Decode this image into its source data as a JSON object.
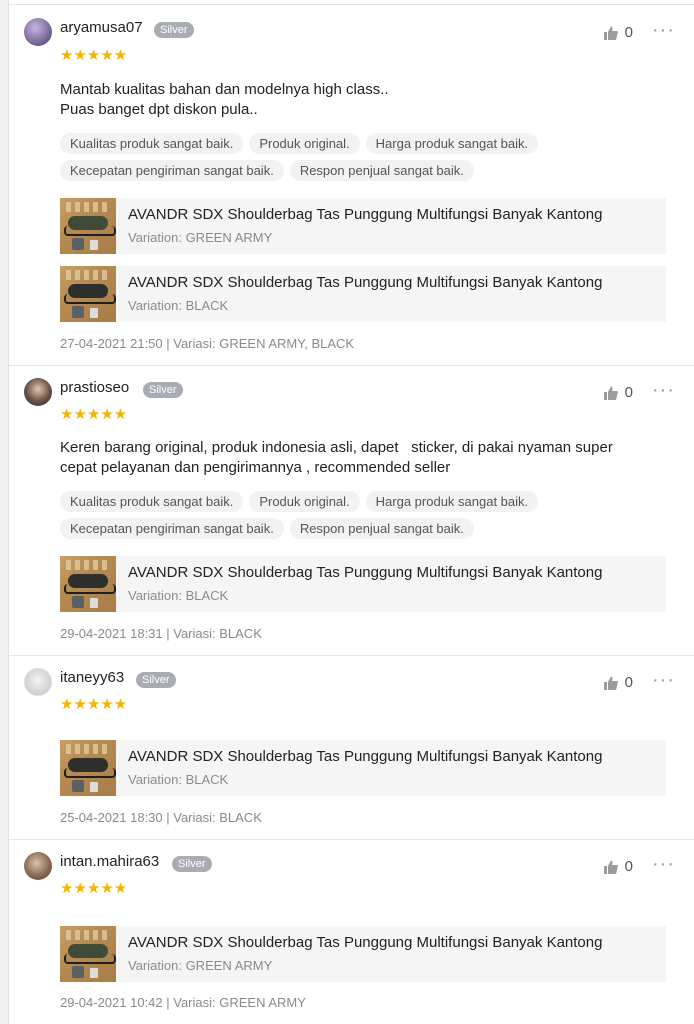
{
  "reviews": [
    {
      "username": "aryamusa07",
      "badge": "Silver",
      "stars": "★★★★★",
      "likes": "0",
      "comment": [
        "Mantab kualitas bahan dan modelnya high class..",
        "Puas banget dpt diskon pula.."
      ],
      "tags": [
        "Kualitas produk sangat baik.",
        "Produk original.",
        "Harga produk sangat baik.",
        "Kecepatan pengiriman sangat baik.",
        "Respon penjual sangat baik."
      ],
      "products": [
        {
          "title": "AVANDR SDX Shoulderbag Tas Punggung Multifungsi Banyak Kantong",
          "variation": "Variation: GREEN ARMY"
        },
        {
          "title": "AVANDR SDX Shoulderbag Tas Punggung Multifungsi Banyak Kantong",
          "variation": "Variation: BLACK"
        }
      ],
      "meta": "27-04-2021 21:50 | Variasi: GREEN ARMY, BLACK"
    },
    {
      "username": "prastioseo",
      "badge": "Silver",
      "stars": "★★★★★",
      "likes": "0",
      "comment": [
        "Keren barang original, produk indonesia asli, dapet   sticker, di pakai nyaman super",
        "cepat pelayanan dan pengirimannya , recommended seller"
      ],
      "tags": [
        "Kualitas produk sangat baik.",
        "Produk original.",
        "Harga produk sangat baik.",
        "Kecepatan pengiriman sangat baik.",
        "Respon penjual sangat baik."
      ],
      "products": [
        {
          "title": "AVANDR SDX Shoulderbag Tas Punggung Multifungsi Banyak Kantong",
          "variation": "Variation: BLACK"
        }
      ],
      "meta": "29-04-2021 18:31 | Variasi: BLACK"
    },
    {
      "username": "itaneyy63",
      "badge": "Silver",
      "stars": "★★★★★",
      "likes": "0",
      "products": [
        {
          "title": "AVANDR SDX Shoulderbag Tas Punggung Multifungsi Banyak Kantong",
          "variation": "Variation: BLACK"
        }
      ],
      "meta": "25-04-2021 18:30 | Variasi: BLACK"
    },
    {
      "username": "intan.mahira63",
      "badge": "Silver",
      "stars": "★★★★★",
      "likes": "0",
      "products": [
        {
          "title": "AVANDR SDX Shoulderbag Tas Punggung Multifungsi Banyak Kantong",
          "variation": "Variation: GREEN ARMY"
        }
      ],
      "meta": "29-04-2021 10:42 | Variasi: GREEN ARMY"
    }
  ],
  "colors": {
    "star": "#f5b400",
    "badge": "#a9adb3"
  },
  "icons": {
    "like": "thumbs-up-icon",
    "more": "more-dots-icon"
  }
}
